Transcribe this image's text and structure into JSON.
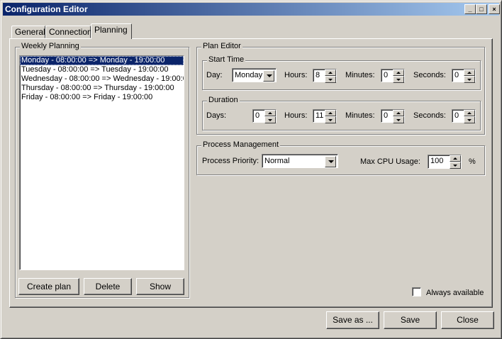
{
  "window": {
    "title": "Configuration Editor"
  },
  "tabs": [
    {
      "label": "General"
    },
    {
      "label": "Connection"
    },
    {
      "label": "Planning"
    }
  ],
  "weekly_planning": {
    "legend": "Weekly Planning",
    "items": [
      "Monday - 08:00:00 => Monday - 19:00:00",
      "Tuesday - 08:00:00 => Tuesday - 19:00:00",
      "Wednesday - 08:00:00 => Wednesday - 19:00:0",
      "Thursday - 08:00:00 => Thursday - 19:00:00",
      "Friday - 08:00:00 => Friday - 19:00:00"
    ],
    "selected_index": 0,
    "buttons": {
      "create": "Create plan",
      "delete": "Delete",
      "show": "Show"
    }
  },
  "plan_editor": {
    "legend": "Plan Editor",
    "start_time": {
      "legend": "Start Time",
      "day_label": "Day:",
      "day_value": "Monday",
      "hours_label": "Hours:",
      "hours_value": "8",
      "minutes_label": "Minutes:",
      "minutes_value": "0",
      "seconds_label": "Seconds:",
      "seconds_value": "0"
    },
    "duration": {
      "legend": "Duration",
      "days_label": "Days:",
      "days_value": "0",
      "hours_label": "Hours:",
      "hours_value": "11",
      "minutes_label": "Minutes:",
      "minutes_value": "0",
      "seconds_label": "Seconds:",
      "seconds_value": "0"
    }
  },
  "process_management": {
    "legend": "Process Management",
    "priority_label": "Process Priority:",
    "priority_value": "Normal",
    "cpu_label": "Max CPU Usage:",
    "cpu_value": "100",
    "cpu_unit": "%"
  },
  "always_available": {
    "label": "Always available",
    "checked": false
  },
  "footer": {
    "save_as": "Save as ...",
    "save": "Save",
    "close": "Close"
  },
  "colors": {
    "title_start": "#0a246a",
    "title_end": "#a6caf0",
    "face": "#d4d0c8",
    "selection": "#0a246a"
  }
}
